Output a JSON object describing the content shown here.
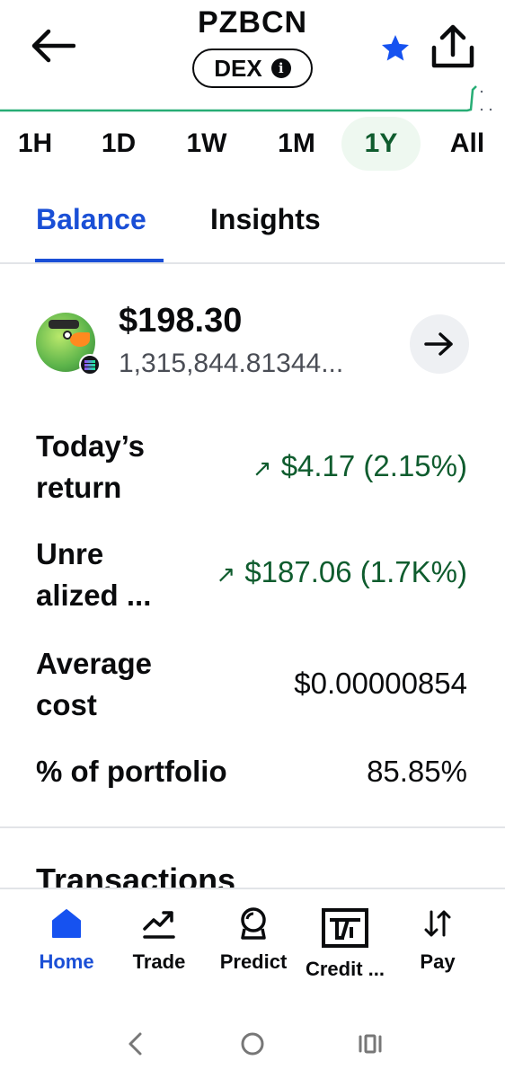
{
  "header": {
    "title": "PZBCN",
    "badge": "DEX",
    "info_glyph": "i",
    "back_icon": "arrow-left-icon",
    "favorite_icon": "star-icon",
    "share_icon": "share-icon",
    "accent_color": "#1652f0"
  },
  "ranges": {
    "items": [
      "1H",
      "1D",
      "1W",
      "1M",
      "1Y",
      "All"
    ],
    "active": "1Y"
  },
  "tabs": {
    "balance": "Balance",
    "insights": "Insights",
    "active": "Balance"
  },
  "holding": {
    "value": "$198.30",
    "amount": "1,315,844.81344...",
    "logo_icon": "parrot-token-logo",
    "chain_icon": "solana-icon",
    "action_icon": "arrow-right-icon"
  },
  "stats": {
    "todays_return": {
      "label_line1": "Today’s",
      "label_line2": "return",
      "value": "$4.17 (2.15%)",
      "direction_glyph": "↗",
      "color": "#0f5c2e"
    },
    "unrealized": {
      "label_line1": "Unre",
      "label_line2": "alized ...",
      "value": "$187.06 (1.7K%)",
      "direction_glyph": "↗",
      "color": "#0f5c2e"
    },
    "average_cost": {
      "label_line1": "Average",
      "label_line2": "cost",
      "value": "$0.00000854"
    },
    "portfolio": {
      "label": "% of portfolio",
      "value": "85.85%"
    }
  },
  "transactions": {
    "heading": "Transactions"
  },
  "bottom_nav": {
    "items": [
      {
        "label": "Home",
        "icon": "home-icon",
        "active": true
      },
      {
        "label": "Trade",
        "icon": "trade-chart-icon",
        "active": false
      },
      {
        "label": "Predict",
        "icon": "predict-icon",
        "active": false
      },
      {
        "label": "Credit ...",
        "icon": "credit-card-icon",
        "active": false
      },
      {
        "label": "Pay",
        "icon": "transfer-arrows-icon",
        "active": false
      }
    ]
  },
  "system_nav": {
    "back": "system-back-icon",
    "home": "system-home-icon",
    "recents": "system-recents-icon"
  }
}
